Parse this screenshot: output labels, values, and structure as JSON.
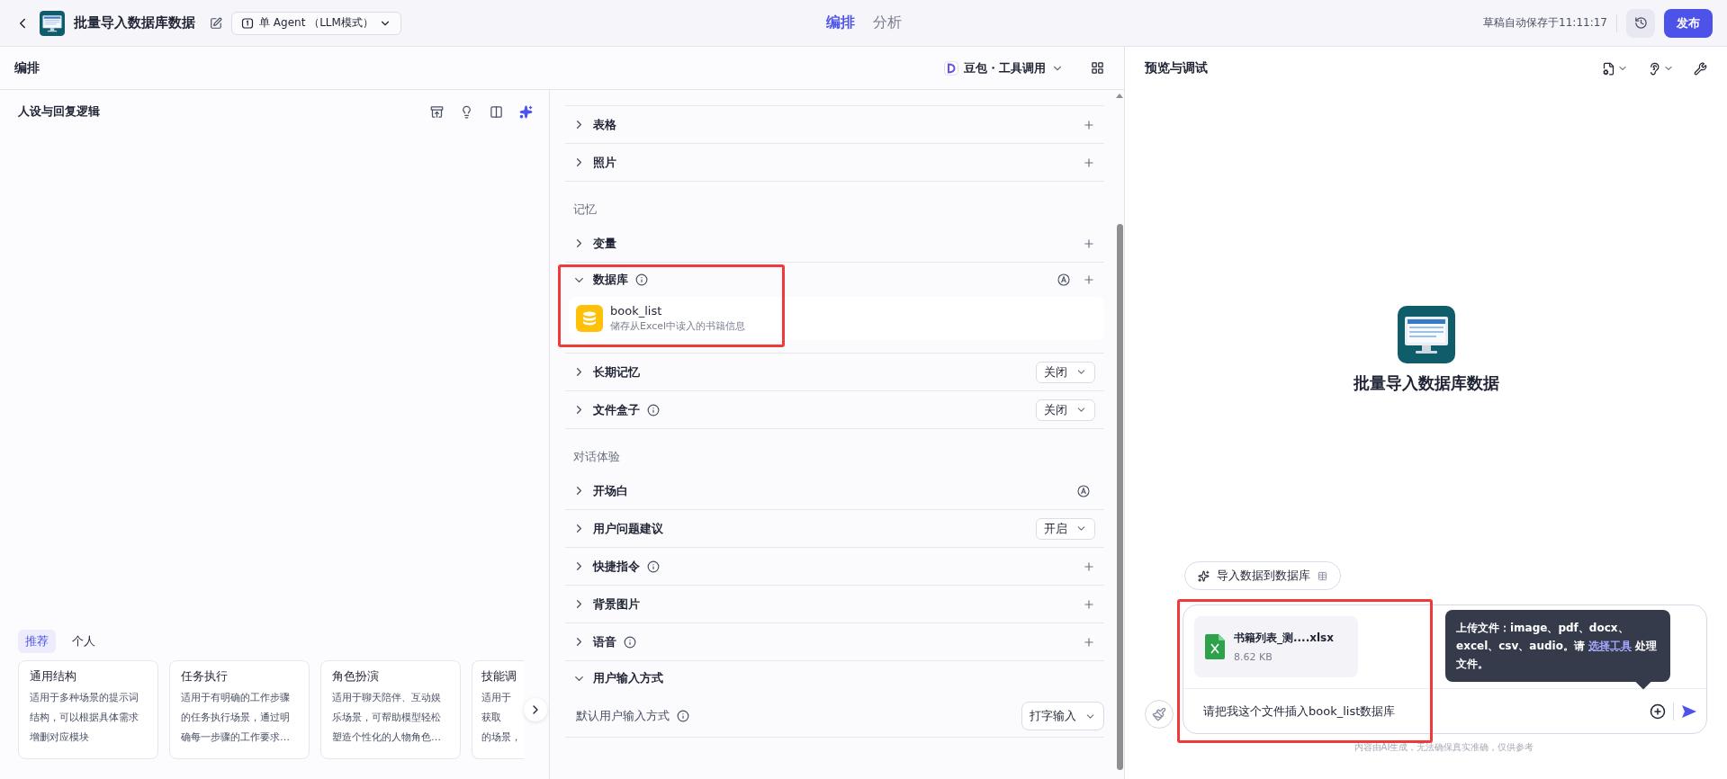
{
  "header": {
    "title": "批量导入数据库数据",
    "agent_mode": "单 Agent （LLM模式）",
    "tabs": [
      {
        "label": "编排",
        "selected": true
      },
      {
        "label": "分析",
        "selected": false
      }
    ],
    "autosave": "草稿自动保存于11:11:17",
    "publish": "发布"
  },
  "editor": {
    "title": "编排",
    "model": "豆包・工具调用"
  },
  "persona": {
    "title": "人设与回复逻辑",
    "template_tabs": [
      {
        "label": "推荐",
        "selected": true
      },
      {
        "label": "个人",
        "selected": false
      }
    ],
    "templates": [
      {
        "title": "通用结构",
        "lines": [
          "适用于多种场景的提示词",
          "结构，可以根据具体需求",
          "增删对应模块"
        ]
      },
      {
        "title": "任务执行",
        "lines": [
          "适用于有明确的工作步骤",
          "的任务执行场景，通过明",
          "确每一步骤的工作要求…"
        ]
      },
      {
        "title": "角色扮演",
        "lines": [
          "适用于聊天陪伴、互动娱",
          "乐场景，可帮助模型轻松",
          "塑造个性化的人物角色…"
        ]
      },
      {
        "title": "技能调",
        "lines": [
          "适用于",
          "获取",
          "的场景，"
        ]
      }
    ]
  },
  "skills": {
    "sections": [
      {
        "items": [
          {
            "label": "表格",
            "kind": "add",
            "info": false,
            "auto": false,
            "expanded": false
          },
          {
            "label": "照片",
            "kind": "add",
            "info": false,
            "auto": false,
            "expanded": false
          }
        ]
      },
      {
        "heading": "记忆",
        "items": [
          {
            "label": "变量",
            "kind": "add",
            "info": false,
            "auto": false,
            "expanded": false
          },
          {
            "label": "数据库",
            "kind": "add",
            "info": true,
            "auto": true,
            "expanded": true,
            "highlighted": true,
            "databases": [
              {
                "name": "book_list",
                "description": "储存从Excel中读入的书籍信息"
              }
            ]
          },
          {
            "label": "长期记忆",
            "kind": "select",
            "value": "关闭",
            "info": false,
            "auto": false,
            "expanded": false
          },
          {
            "label": "文件盒子",
            "kind": "select",
            "value": "关闭",
            "info": true,
            "auto": false,
            "expanded": false
          }
        ]
      },
      {
        "heading": "对话体验",
        "items": [
          {
            "label": "开场白",
            "kind": "plain",
            "info": false,
            "auto": true,
            "expanded": false
          },
          {
            "label": "用户问题建议",
            "kind": "select",
            "value": "开启",
            "info": false,
            "auto": false,
            "expanded": false
          },
          {
            "label": "快捷指令",
            "kind": "add",
            "info": true,
            "auto": false,
            "expanded": false
          },
          {
            "label": "背景图片",
            "kind": "add",
            "info": false,
            "auto": false,
            "expanded": false
          },
          {
            "label": "语音",
            "kind": "add",
            "info": true,
            "auto": false,
            "expanded": false
          },
          {
            "label": "用户输入方式",
            "kind": "plain",
            "info": false,
            "auto": false,
            "expanded": true,
            "setting": {
              "label": "默认用户输入方式",
              "value": "打字输入",
              "info": true
            }
          }
        ]
      }
    ]
  },
  "preview": {
    "title": "预览与调试",
    "bot_name": "批量导入数据库数据",
    "suggestion": "导入数据到数据库",
    "composer": {
      "highlighted": true,
      "attachment": {
        "name": "书籍列表_测....xlsx",
        "size": "8.62 KB"
      },
      "value": "请把我这个文件插入book_list数据库"
    },
    "tooltip": {
      "text_before": "上传文件：image、pdf、docx、excel、csv、audio。请 ",
      "link": "选择工具",
      "text_after": "处理文件。"
    },
    "disclaimer": "内容由AI生成，无法确保真实准确，仅供参考"
  }
}
